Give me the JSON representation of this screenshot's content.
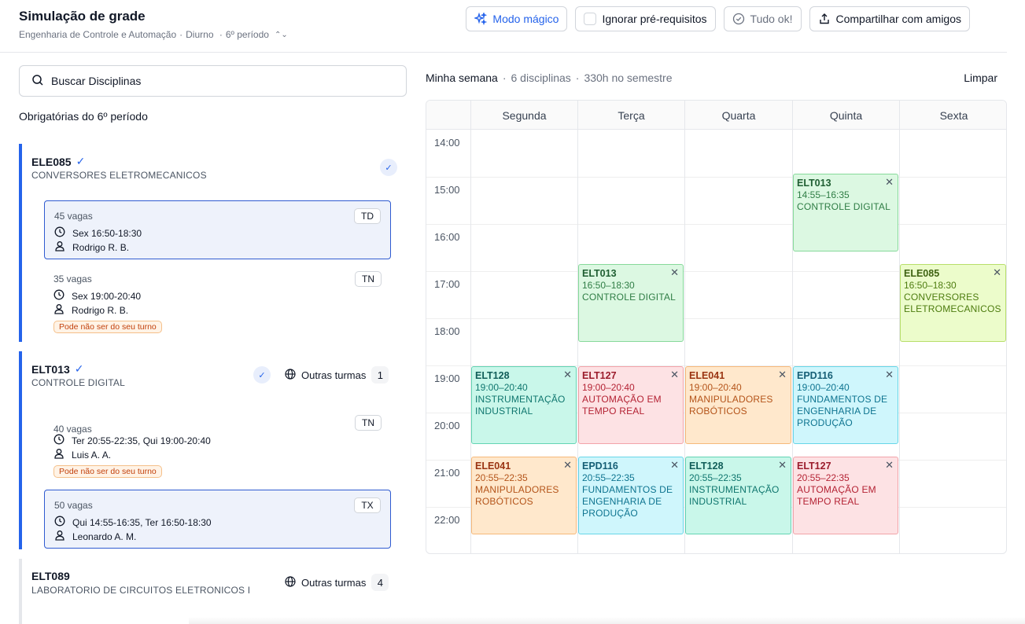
{
  "header": {
    "title": "Simulação de grade",
    "course": "Engenharia de Controle e Automação",
    "shift": "Diurno",
    "period": "6º período"
  },
  "toolbar": {
    "magic_label": "Modo mágico",
    "ignore_label": "Ignorar pré-requisitos",
    "status_label": "Tudo ok!",
    "share_label": "Compartilhar com amigos"
  },
  "search": {
    "label": "Buscar Disciplinas"
  },
  "left": {
    "section_title": "Obrigatórias do 6º período",
    "courses": [
      {
        "code": "ELE085",
        "name": "CONVERSORES ELETROMECANICOS",
        "sections": [
          {
            "vagas": "45 vagas",
            "turno": "TD",
            "schedule": "Sex 16:50-18:30",
            "teacher": "Rodrigo R. B."
          },
          {
            "vagas": "35 vagas",
            "turno": "TN",
            "schedule": "Sex 19:00-20:40",
            "teacher": "Rodrigo R. B.",
            "warning": "Pode não ser do seu turno"
          }
        ]
      },
      {
        "code": "ELT013",
        "name": "CONTROLE DIGITAL",
        "outras_label": "Outras turmas",
        "outras_count": "1",
        "sections": [
          {
            "vagas": "40 vagas",
            "turno": "TN",
            "schedule": "Ter 20:55-22:35, Qui 19:00-20:40",
            "teacher": "Luis A. A.",
            "warning": "Pode não ser do seu turno"
          },
          {
            "vagas": "50 vagas",
            "turno": "TX",
            "schedule": "Qui 14:55-16:35, Ter 16:50-18:30",
            "teacher": "Leonardo A. M."
          }
        ]
      },
      {
        "code": "ELT089",
        "name": "LABORATORIO DE CIRCUITOS ELETRONICOS I",
        "outras_label": "Outras turmas",
        "outras_count": "4"
      }
    ]
  },
  "week": {
    "title": "Minha semana",
    "disciplines": "6 disciplinas",
    "hours": "330h no semestre",
    "clear_label": "Limpar",
    "days": [
      "Segunda",
      "Terça",
      "Quarta",
      "Quinta",
      "Sexta"
    ],
    "hours_labels": [
      "14:00",
      "15:00",
      "16:00",
      "17:00",
      "18:00",
      "19:00",
      "20:00",
      "21:00",
      "22:00"
    ],
    "events": [
      {
        "code": "ELT013",
        "time": "14:55–16:35",
        "name": "CONTROLE DIGITAL"
      },
      {
        "code": "ELT013",
        "time": "16:50–18:30",
        "name": "CONTROLE DIGITAL"
      },
      {
        "code": "ELE085",
        "time": "16:50–18:30",
        "name": "CONVERSORES ELETROMECANICOS"
      },
      {
        "code": "ELT128",
        "time": "19:00–20:40",
        "name": "INSTRUMENTAÇÃO INDUSTRIAL"
      },
      {
        "code": "ELT127",
        "time": "19:00–20:40",
        "name": "AUTOMAÇÃO EM TEMPO REAL"
      },
      {
        "code": "ELE041",
        "time": "19:00–20:40",
        "name": "MANIPULADORES ROBÓTICOS"
      },
      {
        "code": "EPD116",
        "time": "19:00–20:40",
        "name": "FUNDAMENTOS DE ENGENHARIA DE PRODUÇÃO"
      },
      {
        "code": "ELE041",
        "time": "20:55–22:35",
        "name": "MANIPULADORES ROBÓTICOS"
      },
      {
        "code": "EPD116",
        "time": "20:55–22:35",
        "name": "FUNDAMENTOS DE ENGENHARIA DE PRODUÇÃO"
      },
      {
        "code": "ELT128",
        "time": "20:55–22:35",
        "name": "INSTRUMENTAÇÃO INDUSTRIAL"
      },
      {
        "code": "ELT127",
        "time": "20:55–22:35",
        "name": "AUTOMAÇÃO EM TEMPO REAL"
      }
    ]
  }
}
